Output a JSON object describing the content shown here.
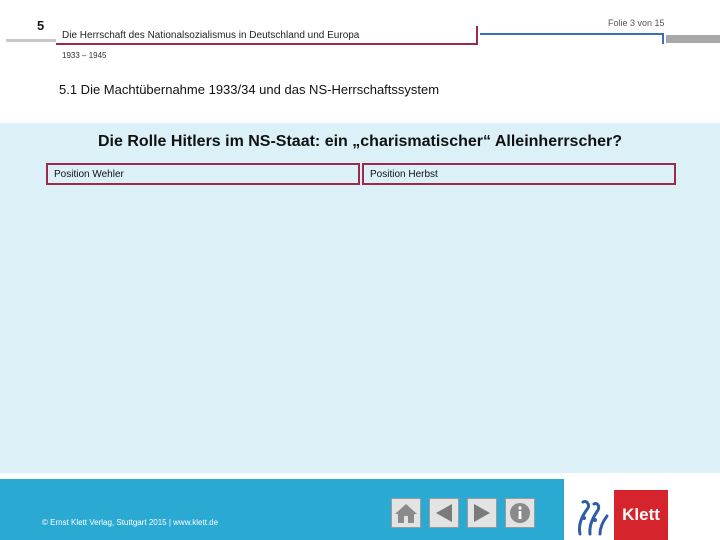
{
  "header": {
    "chapter_number": "5",
    "chapter_title": "Die Herrschaft des Nationalsozialismus in Deutschland und Europa",
    "years": "1933 – 1945",
    "slide_counter": "Folie 3 von 15",
    "section_title": "5.1 Die Machtübernahme 1933/34 und das NS-Herrschaftssystem"
  },
  "main": {
    "question": "Die Rolle Hitlers im NS-Staat: ein „charismatischer“ Alleinherrscher?",
    "positions": [
      {
        "label": "Position Wehler"
      },
      {
        "label": "Position Herbst"
      }
    ]
  },
  "footer": {
    "copyright": "© Ernst Klett Verlag, Stuttgart 2015 | www.klett.de",
    "nav_icons": [
      "home-icon",
      "prev-arrow-icon",
      "next-arrow-icon",
      "info-icon"
    ]
  },
  "logo": {
    "wordmark": "Klett"
  },
  "colors": {
    "accent_magenta": "#9c2a4e",
    "accent_blue": "#3b6fb6",
    "content_bg": "#dbf1f7",
    "footer_bg": "#2aaad3",
    "logo_red": "#d5242b"
  }
}
